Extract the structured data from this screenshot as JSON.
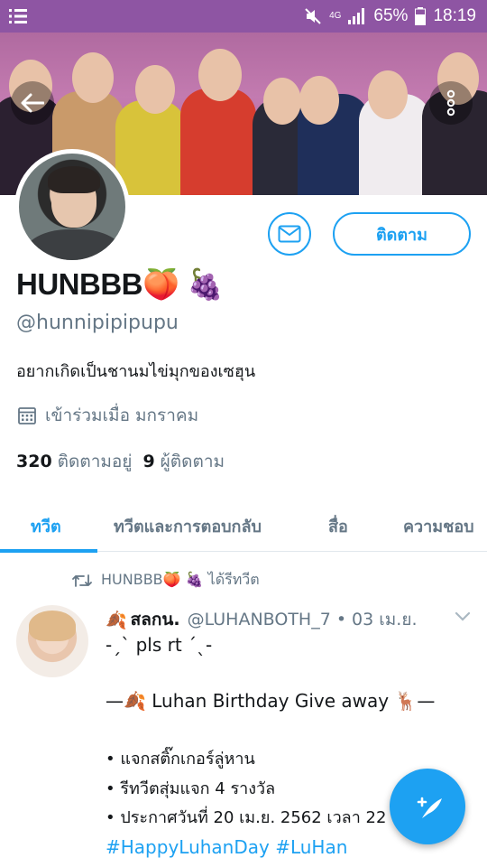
{
  "status_bar": {
    "network": "4G",
    "battery": "65%",
    "time": "18:19"
  },
  "profile": {
    "display_name": "HUNBBB🍑 🍇",
    "handle": "@hunnipipipupu",
    "bio": "อยากเกิดเป็นชานมไข่มุกของเซฮุน",
    "joined": "เข้าร่วมเมื่อ มกราคม",
    "following_count": "320",
    "following_label": "ติดตามอยู่",
    "followers_count": "9",
    "followers_label": "ผู้ติดตาม",
    "follow_button": "ติดตาม"
  },
  "tabs": [
    {
      "label": "ทวีต",
      "active": true
    },
    {
      "label": "ทวีตและการตอบกลับ",
      "active": false
    },
    {
      "label": "สื่อ",
      "active": false
    },
    {
      "label": "ความชอบ",
      "active": false
    }
  ],
  "tweet": {
    "retweet_label": "HUNBBB🍑 🍇 ได้รีทวีต",
    "author_emoji": "🍂",
    "author_name": "สลกน.",
    "author_handle": "@LUHANBOTH_7",
    "date": "• 03 เม.ย.",
    "lines": [
      "-ˏˋ pls rt ˊˎ-",
      "—🍂 Luhan Birthday Give away 🦌—",
      "• แจกสติ๊กเกอร์ลู่หาน",
      "• รีทวีตสุ่มแจก 4 รางวัล",
      "• ประกาศวันที่ 20 เม.ย. 2562 เวลา 22"
    ],
    "hashtags": "#HappyLuhanDay #LuHan"
  },
  "colors": {
    "accent": "#1da1f2",
    "secondary_text": "#657786",
    "status_bar": "#8e55a3"
  },
  "icons": [
    "menu-icon",
    "mute-icon",
    "signal-icon",
    "battery-icon",
    "back-arrow-icon",
    "more-vertical-icon",
    "mail-icon",
    "calendar-icon",
    "retweet-icon",
    "chevron-down-icon",
    "compose-icon"
  ]
}
